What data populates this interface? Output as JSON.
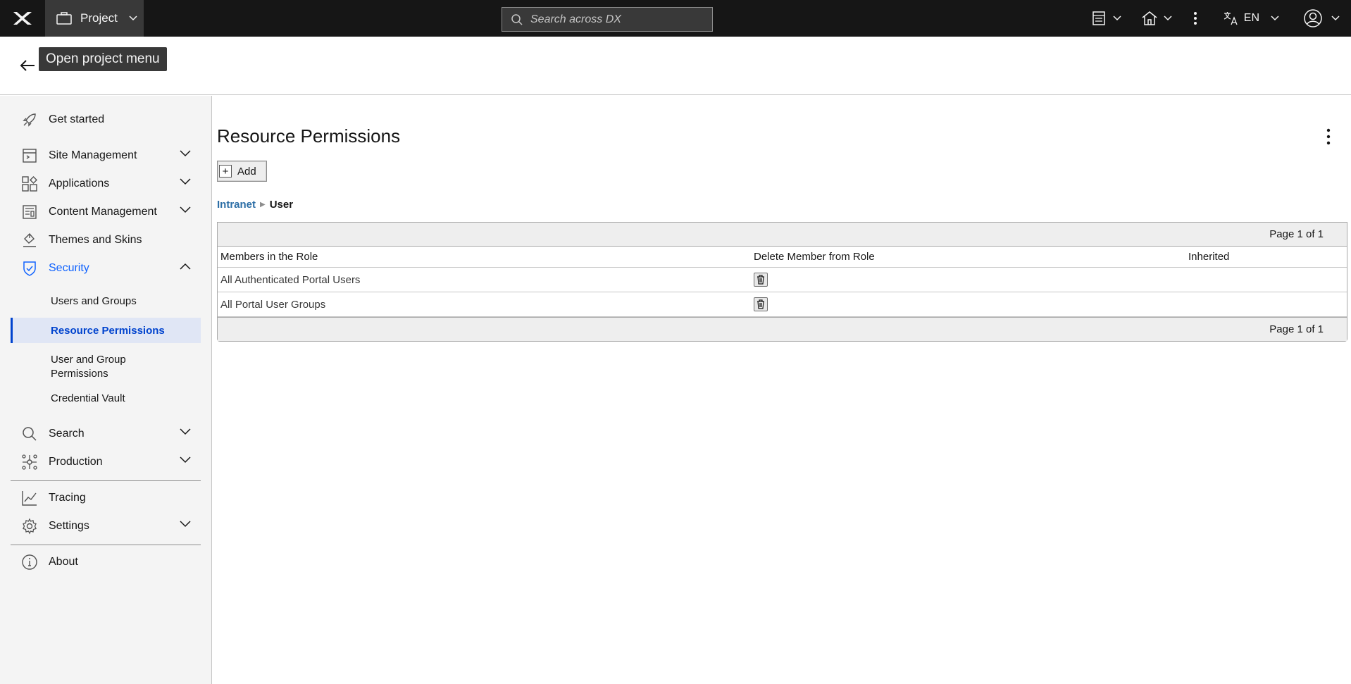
{
  "topbar": {
    "project_label": "Project",
    "search_placeholder": "Search across DX",
    "language": "EN"
  },
  "header": {
    "tooltip": "Open project menu"
  },
  "sidebar": {
    "items": [
      {
        "label": "Get started"
      },
      {
        "label": "Site Management"
      },
      {
        "label": "Applications"
      },
      {
        "label": "Content Management"
      },
      {
        "label": "Themes and Skins"
      },
      {
        "label": "Security"
      },
      {
        "label": "Search"
      },
      {
        "label": "Production"
      },
      {
        "label": "Tracing"
      },
      {
        "label": "Settings"
      },
      {
        "label": "About"
      }
    ],
    "security_sub": [
      {
        "label": "Users and Groups"
      },
      {
        "label": "Resource Permissions"
      },
      {
        "label": "User and Group Permissions"
      },
      {
        "label": "Credential Vault"
      }
    ]
  },
  "main": {
    "title": "Resource Permissions",
    "add_label": "Add",
    "breadcrumb": {
      "parent": "Intranet",
      "current": "User"
    },
    "pager_text": "Page 1 of 1",
    "columns": [
      "Members in the Role",
      "Delete Member from Role",
      "Inherited"
    ],
    "rows": [
      {
        "member": "All Authenticated Portal Users"
      },
      {
        "member": "All Portal User Groups"
      }
    ]
  },
  "colors": {
    "topbar_bg": "#161616",
    "accent": "#0f62fe",
    "selected_bg": "#e0e6f5",
    "link": "#2c6ea6"
  }
}
